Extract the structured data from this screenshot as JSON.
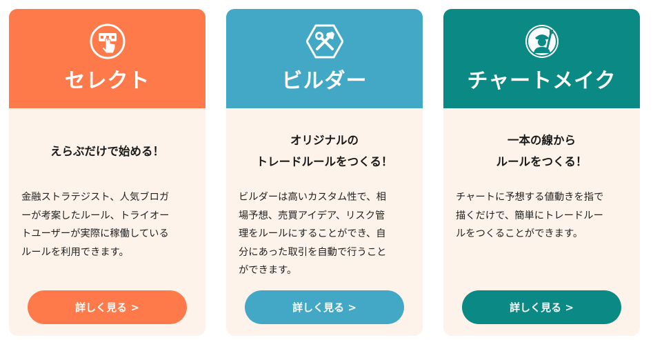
{
  "cards": [
    {
      "id": "select",
      "title": "セレクト",
      "icon": "tap-menu-icon",
      "color": "#ff7a4a",
      "tagline": [
        "えらぶだけで始める！"
      ],
      "description": [
        "金融ストラテジスト、人気ブロガ",
        "ーが考案したルール、トライオー",
        "トユーザーが実際に稼働している",
        "ルールを利用できます。"
      ],
      "button_label": "詳しく見る >"
    },
    {
      "id": "builder",
      "title": "ビルダー",
      "icon": "tools-icon",
      "color": "#43a8c6",
      "tagline": [
        "オリジナルの",
        "トレードルールをつくる！"
      ],
      "description": [
        "ビルダーは高いカスタム性で、相",
        "場予想、売買アイデア、リスク管",
        "理をルールにすることができ、自",
        "分にあった取引を自動で行うこと",
        "ができます。"
      ],
      "button_label": "詳しく見る >"
    },
    {
      "id": "chartmake",
      "title": "チャートメイク",
      "icon": "painter-icon",
      "color": "#0a8985",
      "tagline": [
        "一本の線から",
        "ルールをつくる！"
      ],
      "description": [
        "チャートに予想する値動きを指で",
        "描くだけで、簡単にトレードルー",
        "ルをつくることができます。"
      ],
      "button_label": "詳しく見る >"
    }
  ]
}
